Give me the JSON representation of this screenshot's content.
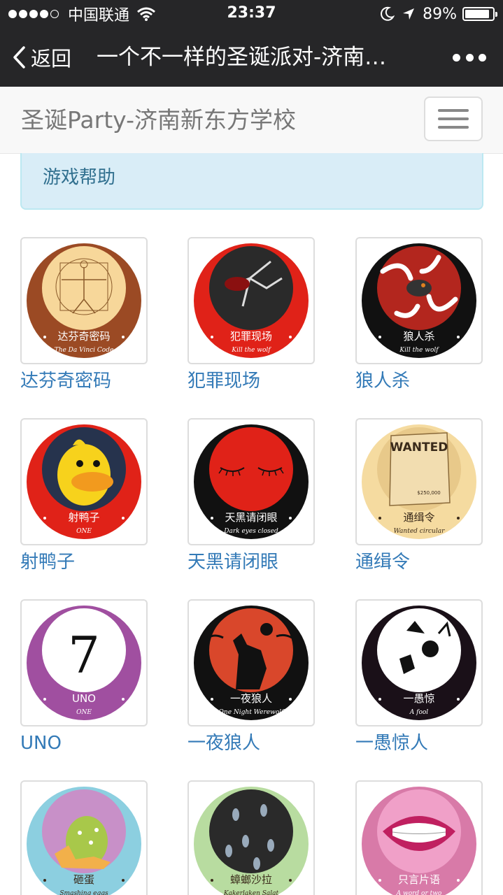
{
  "status_bar": {
    "carrier": "中国联通",
    "time": "23:37",
    "battery": "89%",
    "battery_level": 0.89,
    "signal_bars": 4
  },
  "nav_bar": {
    "back_label": "返回",
    "title": "一个不一样的圣诞派对-济南…"
  },
  "site": {
    "brand": "圣诞Party-济南新东方学校",
    "help_link": "游戏帮助"
  },
  "games": [
    {
      "label": "达芬奇密码",
      "badge_cn": "达芬奇密码",
      "badge_en": "The Da Vinci Code",
      "ring": "#9b4a24",
      "inner": "#f7d79a",
      "art": "vitruvian"
    },
    {
      "label": "犯罪现场",
      "badge_cn": "犯罪现场",
      "badge_en": "Kill the wolf",
      "ring": "#e02218",
      "inner": "#2a2a2a",
      "art": "crime"
    },
    {
      "label": "狼人杀",
      "badge_cn": "狼人杀",
      "badge_en": "Kill the wolf",
      "ring": "#111111",
      "inner": "#b3261e",
      "art": "wolfhands"
    },
    {
      "label": "射鸭子",
      "badge_cn": "射鸭子",
      "badge_en": "ONE",
      "ring": "#e02218",
      "inner": "#26334d",
      "art": "duck"
    },
    {
      "label": "天黑请闭眼",
      "badge_cn": "天黑请闭眼",
      "badge_en": "Dark eyes closed",
      "ring": "#111111",
      "inner": "#e02218",
      "art": "eyes"
    },
    {
      "label": "通缉令",
      "badge_cn": "通缉令",
      "badge_en": "Wanted circular",
      "ring": "#f5dba0",
      "inner": "#e8c98a",
      "art": "wanted",
      "wanted_title": "WANTED",
      "wanted_reward": "$250,000"
    },
    {
      "label": "UNO",
      "badge_cn": "UNO",
      "badge_en": "ONE",
      "ring": "#a04fa0",
      "inner": "#ffffff",
      "art": "uno",
      "uno_digit": "7"
    },
    {
      "label": "一夜狼人",
      "badge_cn": "一夜狼人",
      "badge_en": "One Night Werewolf",
      "ring": "#111111",
      "inner": "#d9472b",
      "art": "werewolf"
    },
    {
      "label": "一愚惊人",
      "badge_cn": "一愚惊",
      "badge_en": "A fool",
      "ring": "#1a1018",
      "inner": "#ffffff",
      "art": "fool"
    },
    {
      "label": "砸蛋",
      "badge_cn": "砸蛋",
      "badge_en": "Smashing eggs",
      "ring": "#8ccfe0",
      "inner": "#c890c8",
      "art": "egg"
    },
    {
      "label": "蟑螂沙拉",
      "badge_cn": "蟑螂沙拉",
      "badge_en": "Kakerlaken Salat",
      "ring": "#b8dca0",
      "inner": "#2a2a2a",
      "art": "roach"
    },
    {
      "label": "只言片语",
      "badge_cn": "只言片语",
      "badge_en": "A word or two",
      "ring": "#d87aa8",
      "inner": "#f0a0c8",
      "art": "mouth"
    }
  ]
}
